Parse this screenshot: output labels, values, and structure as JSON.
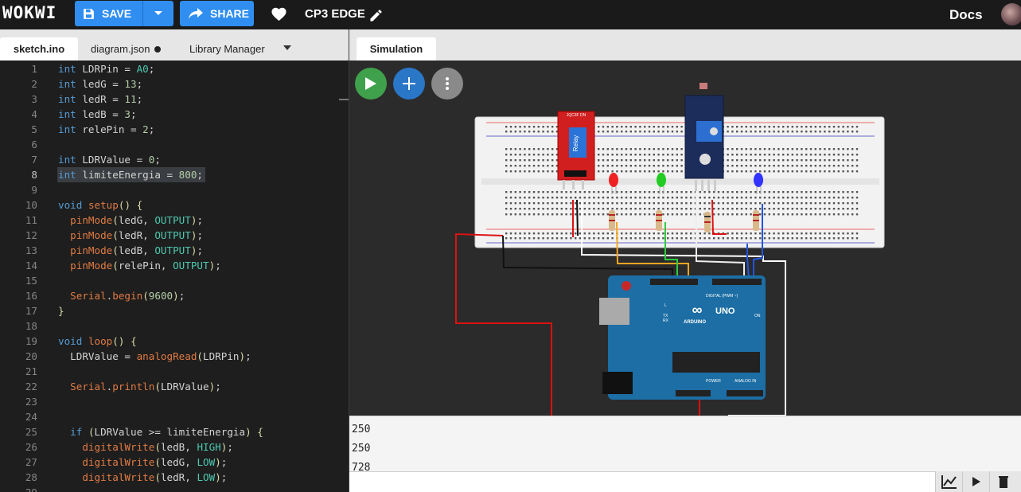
{
  "app": {
    "logo": "WOKWI",
    "save_label": "SAVE",
    "share_label": "SHARE",
    "project_title": "CP3 EDGE",
    "docs_label": "Docs"
  },
  "editor_tabs": [
    {
      "label": "sketch.ino",
      "active": true
    },
    {
      "label": "diagram.json",
      "modified": true
    },
    {
      "label": "Library Manager"
    }
  ],
  "sim_tab": "Simulation",
  "code": {
    "current_line": 8,
    "lines": [
      "int LDRPin = A0;",
      "int ledG = 13;",
      "int ledR = 11;",
      "int ledB = 3;",
      "int relePin = 2;",
      "",
      "int LDRValue = 0;",
      "int limiteEnergia = 800;",
      "",
      "void setup() {",
      "  pinMode(ledG, OUTPUT);",
      "  pinMode(ledR, OUTPUT);",
      "  pinMode(ledB, OUTPUT);",
      "  pinMode(relePin, OUTPUT);",
      "",
      "  Serial.begin(9600);",
      "}",
      "",
      "void loop() {",
      "  LDRValue = analogRead(LDRPin);",
      "",
      "  Serial.println(LDRValue);",
      "",
      "",
      "  if (LDRValue >= limiteEnergia) {",
      "    digitalWrite(ledB, HIGH);",
      "    digitalWrite(ledG, LOW);",
      "    digitalWrite(ledR, LOW);",
      ""
    ]
  },
  "serial_output": [
    "250",
    "250",
    "728"
  ],
  "board": {
    "relay_label": "Relay",
    "relay_header": "JQC3F DN",
    "arduino_brand": "ARDUINO",
    "arduino_model": "UNO",
    "digital_label": "DIGITAL (PWM ~)",
    "power_label": "POWER",
    "analog_label": "ANALOG IN",
    "on_label": "ON",
    "l_label": "L",
    "tx_label": "TX",
    "rx_label": "RX"
  },
  "icons": {
    "save": "floppy-icon",
    "dropdown": "chevron-down-icon",
    "share": "share-arrow-icon",
    "heart": "heart-icon",
    "edit": "pencil-icon",
    "play": "play-icon",
    "add": "plus-icon",
    "more": "more-vertical-icon",
    "plotter": "chart-icon",
    "trash": "trash-icon"
  },
  "colors": {
    "accent": "#2f8ef0",
    "play": "#3fa14b",
    "add": "#2a76c7"
  }
}
